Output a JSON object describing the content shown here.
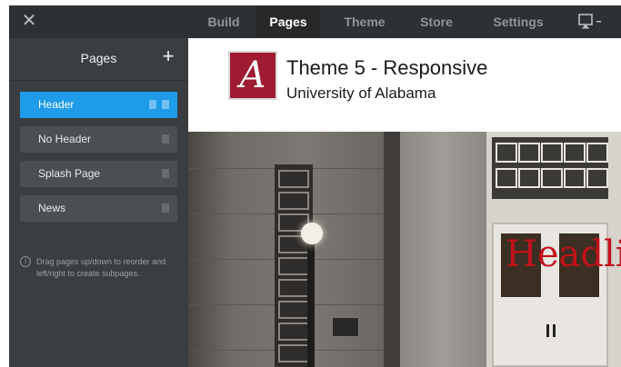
{
  "topbar": {
    "close_icon": "close-icon",
    "tabs": [
      {
        "label": "Build",
        "active": false
      },
      {
        "label": "Pages",
        "active": true
      },
      {
        "label": "Theme",
        "active": false
      },
      {
        "label": "Store",
        "active": false
      },
      {
        "label": "Settings",
        "active": false
      }
    ],
    "device_icon": "monitor-dropdown-icon"
  },
  "sidebar": {
    "title": "Pages",
    "add_label": "+",
    "items": [
      {
        "label": "Header",
        "active": true,
        "icons": [
          "home-icon",
          "page-icon"
        ]
      },
      {
        "label": "No Header",
        "active": false,
        "icons": [
          "page-icon"
        ]
      },
      {
        "label": "Splash Page",
        "active": false,
        "icons": [
          "page-icon"
        ]
      },
      {
        "label": "News",
        "active": false,
        "icons": [
          "blog-icon"
        ]
      }
    ],
    "hint": "Drag pages up/down to reorder and left/right to create subpages.",
    "hint_icon": "info-icon"
  },
  "preview": {
    "logo_letter": "A",
    "title": "Theme 5 - Responsive",
    "subtitle": "University of Alabama",
    "headline": "Headli"
  },
  "colors": {
    "topbar_bg": "#2e3133",
    "sidebar_bg": "#3a3e40",
    "active_item": "#1e9be9",
    "logo_bg": "#9e1b32",
    "headline_red": "#c0121a"
  }
}
